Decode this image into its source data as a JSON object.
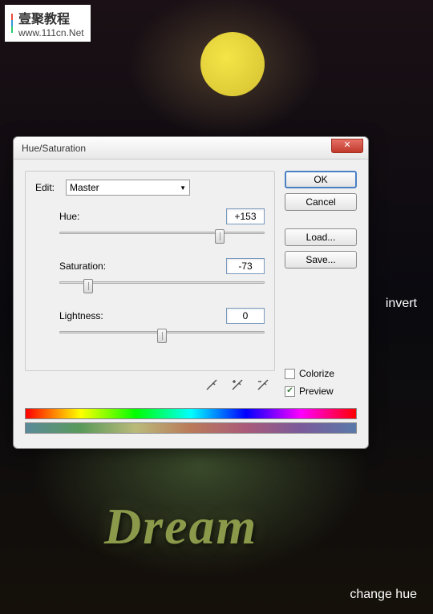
{
  "watermark": {
    "cn": "壹聚教程",
    "url": "www.111cn.Net"
  },
  "labels": {
    "invert": "invert",
    "change_hue": "change hue"
  },
  "artwork": {
    "text": "Dream"
  },
  "dialog": {
    "title": "Hue/Saturation",
    "close": "✕",
    "edit_label": "Edit:",
    "edit_value": "Master",
    "sliders": {
      "hue": {
        "label": "Hue:",
        "value": "+153",
        "pos": 78
      },
      "saturation": {
        "label": "Saturation:",
        "value": "-73",
        "pos": 14
      },
      "lightness": {
        "label": "Lightness:",
        "value": "0",
        "pos": 50
      }
    },
    "buttons": {
      "ok": "OK",
      "cancel": "Cancel",
      "load": "Load...",
      "save": "Save..."
    },
    "checkboxes": {
      "colorize": {
        "label": "Colorize",
        "checked": false
      },
      "preview": {
        "label": "Preview",
        "checked": true
      }
    }
  }
}
